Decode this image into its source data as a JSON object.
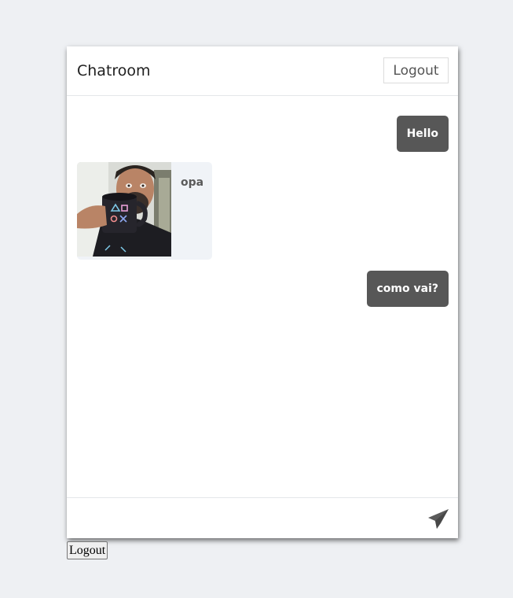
{
  "header": {
    "title": "Chatroom",
    "logout_label": "Logout"
  },
  "messages": [
    {
      "direction": "outgoing",
      "text": "Hello"
    },
    {
      "direction": "incoming",
      "text": "opa",
      "has_image": true
    },
    {
      "direction": "outgoing",
      "text": "como vai?"
    }
  ],
  "composer": {
    "value": "",
    "send_icon": "paper-plane-icon"
  },
  "page": {
    "logout_label": "Logout"
  },
  "colors": {
    "outgoing_bubble": "#575757",
    "incoming_bubble": "#f0f3f7",
    "background": "#eef0f3"
  }
}
